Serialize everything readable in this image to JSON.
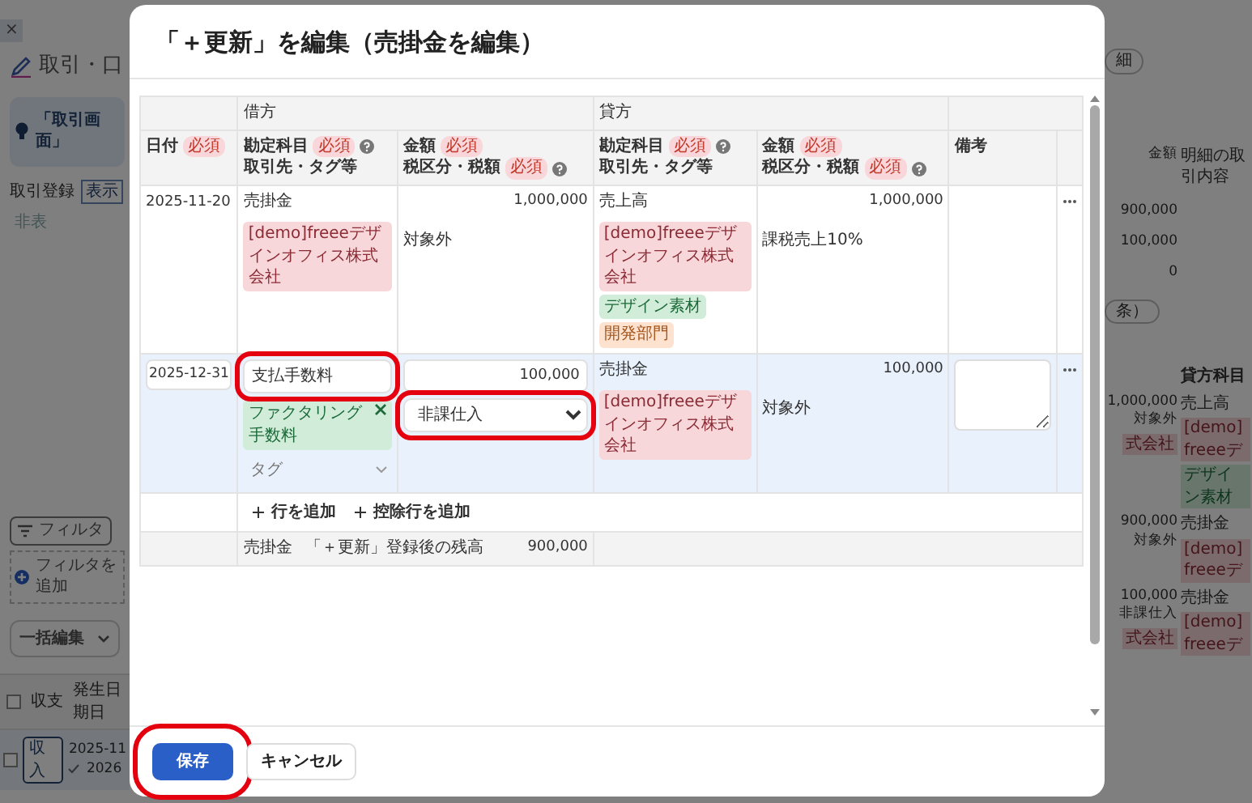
{
  "background_page": {
    "close_mark": "×",
    "page_title": "取引・口",
    "tip": "「取引画面」",
    "registration": {
      "label": "取引登録",
      "options": [
        {
          "label": "表示",
          "selected": true
        },
        {
          "label": "非表",
          "selected": false
        }
      ]
    },
    "filter_button": "フィルタ",
    "add_filter": "フィルタを追加",
    "bulk_edit": "一括編集",
    "list": {
      "header_checked": false,
      "columns": [
        "収支",
        "発生日",
        "期日"
      ],
      "rows": [
        {
          "checked": false,
          "type": "収入",
          "date": "2025-11",
          "due": "2026"
        }
      ]
    },
    "right_top_pill": "細",
    "right_columns": [
      "金額",
      "明細の取引内容"
    ],
    "right_amounts": [
      "900,000",
      "100,000",
      "0"
    ],
    "right_mid_pill": "条）",
    "right_table": {
      "header": "貸方科目",
      "entries": [
        {
          "amount": "1,000,000",
          "tax": "対象外",
          "debit_tag": {
            "label": "式会社",
            "kind": "partner"
          },
          "credit_account": "売上高",
          "credit_tags": [
            {
              "label": "[demo]freeeデ",
              "kind": "partner"
            },
            {
              "label": "デザイン素材",
              "kind": "item"
            }
          ]
        },
        {
          "amount": "900,000",
          "tax": "対象外",
          "credit_account": "売掛金",
          "credit_tags": [
            {
              "label": "[demo]freeeデ",
              "kind": "partner"
            }
          ]
        },
        {
          "amount": "100,000",
          "tax": "非課仕入",
          "debit_tag": {
            "label": "式会社",
            "kind": "partner"
          },
          "credit_account": "売掛金",
          "credit_tags": [
            {
              "label": "[demo]freeeデ",
              "kind": "partner"
            }
          ]
        }
      ]
    }
  },
  "modal": {
    "title": "「＋更新」を編集（売掛金を編集）",
    "table": {
      "group_headers": [
        "借方",
        "貸方"
      ],
      "columns": [
        {
          "lines": [
            {
              "label": "日付",
              "badge": "必須",
              "help": false
            }
          ]
        },
        {
          "lines": [
            {
              "label": "勘定科目",
              "badge": "必須",
              "help": true
            },
            {
              "label": "取引先・タグ等",
              "help": false
            }
          ]
        },
        {
          "lines": [
            {
              "label": "金額",
              "badge": "必須",
              "help": false
            },
            {
              "label": "税区分・税額",
              "badge": "必須",
              "help": true
            }
          ]
        },
        {
          "lines": [
            {
              "label": "勘定科目",
              "badge": "必須",
              "help": true
            },
            {
              "label": "取引先・タグ等",
              "help": false
            }
          ]
        },
        {
          "lines": [
            {
              "label": "金額",
              "badge": "必須",
              "help": false
            },
            {
              "label": "税区分・税額",
              "badge": "必須",
              "help": true
            }
          ]
        },
        {
          "lines": [
            {
              "label": "備考",
              "help": false
            }
          ]
        }
      ],
      "rows": [
        {
          "kind": "display",
          "date": "2025-11-20",
          "debit": {
            "account": "売掛金",
            "tags": [
              {
                "label": "[demo]freeeデザインオフィス株式会社",
                "kind": "partner",
                "color": "#f8d7da",
                "removable": false
              }
            ],
            "amount": "1,000,000",
            "tax": "対象外"
          },
          "credit": {
            "account": "売上高",
            "tags": [
              {
                "label": "[demo]freeeデザインオフィス株式会社",
                "kind": "partner",
                "color": "#f8d7da",
                "removable": false
              },
              {
                "label": "デザイン素材",
                "kind": "item",
                "color": "#d1ecd9",
                "removable": false
              },
              {
                "label": "開発部門",
                "kind": "section",
                "color": "#fde3cf",
                "removable": false
              }
            ],
            "amount": "1,000,000",
            "tax": "課税売上10%"
          }
        },
        {
          "kind": "edit",
          "date": "2025-12-31",
          "debit": {
            "account": "支払手数料",
            "account_highlighted": true,
            "tags": [
              {
                "label": "ファクタリング手数料",
                "kind": "item",
                "color": "#d1ecd9",
                "removable": true
              }
            ],
            "tag_placeholder": "タグ",
            "amount": "100,000",
            "tax": "非課仕入",
            "tax_highlighted": true
          },
          "credit": {
            "account": "売掛金",
            "tags": [
              {
                "label": "[demo]freeeデザインオフィス株式会社",
                "kind": "partner",
                "color": "#f8d7da",
                "removable": false
              }
            ],
            "amount": "100,000",
            "tax": "対象外"
          }
        }
      ],
      "add_buttons": [
        {
          "label": "行を追加"
        },
        {
          "label": "控除行を追加"
        }
      ],
      "balance": {
        "account": "売掛金",
        "label": "「＋更新」登録後の残高",
        "amount": "900,000"
      }
    },
    "footer_buttons": [
      {
        "label": "保存",
        "kind": "primary",
        "highlighted": true
      },
      {
        "label": "キャンセル",
        "kind": "secondary",
        "highlighted": false
      }
    ]
  }
}
